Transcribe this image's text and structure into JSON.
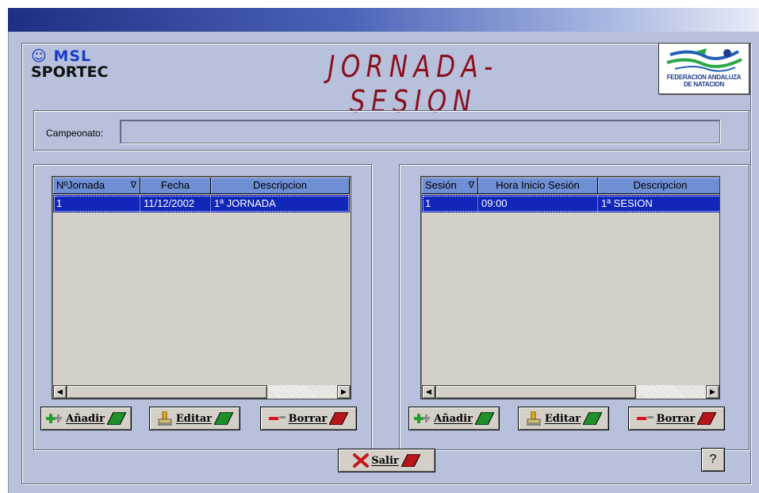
{
  "window": {
    "title_bar_text": ""
  },
  "header": {
    "logo_msl_top": "MSL",
    "logo_msl_bottom": "SPORTEC",
    "title": "JORNADA-SESION",
    "federation_logo_line1": "FEDERACION ANDALUZA",
    "federation_logo_line2": "DE NATACION"
  },
  "campeonato": {
    "label": "Campeonato:",
    "value": ""
  },
  "jornadas": {
    "columns": [
      "NºJornada",
      "Fecha",
      "Descripcion"
    ],
    "sort_indicator": "∇",
    "rows": [
      {
        "numero": "1",
        "fecha": "11/12/2002",
        "descripcion": "1ª JORNADA"
      }
    ],
    "buttons": {
      "add": "Añadir",
      "edit": "Editar",
      "delete": "Borrar"
    }
  },
  "sesiones": {
    "columns": [
      "Sesión",
      "Hora Inicio Sesión",
      "Descripcion"
    ],
    "sort_indicator": "∇",
    "rows": [
      {
        "sesion": "1",
        "hora": "09:00",
        "descripcion": "1ª SESION"
      }
    ],
    "buttons": {
      "add": "Añadir",
      "edit": "Editar",
      "delete": "Borrar"
    }
  },
  "footer": {
    "exit": "Salir",
    "help": "?"
  },
  "colors": {
    "form_background": "#b7c1db",
    "header_cell": "#6e8fd4",
    "selected_row": "#1226b9",
    "title_text": "#8b1020",
    "add_green": "#22a02a",
    "delete_red": "#d9151b"
  }
}
